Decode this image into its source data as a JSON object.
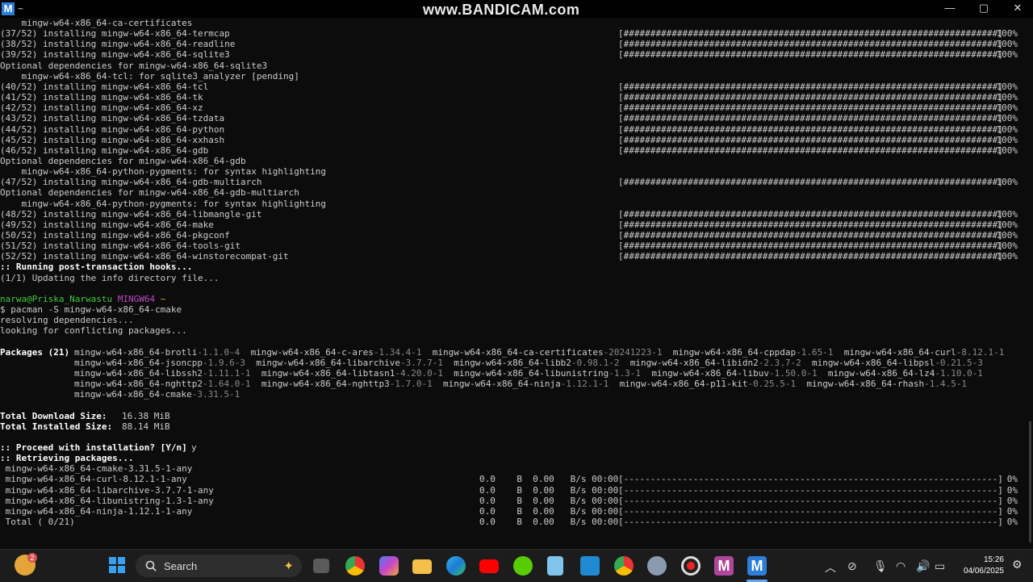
{
  "window": {
    "icon_letter": "M",
    "title": "~",
    "watermark": "www.BANDICAM.com",
    "minimize": "—",
    "maximize": "▢",
    "close": "✕"
  },
  "install_lines": [
    {
      "text": "    mingw-w64-x86_64-ca-certificates",
      "bar": "",
      "pct": ""
    },
    {
      "text": "(37/52) installing mingw-w64-x86_64-termcap",
      "bar": "[######################################################################]",
      "pct": "100%"
    },
    {
      "text": "(38/52) installing mingw-w64-x86_64-readline",
      "bar": "[######################################################################]",
      "pct": "100%"
    },
    {
      "text": "(39/52) installing mingw-w64-x86_64-sqlite3",
      "bar": "[######################################################################]",
      "pct": "100%"
    },
    {
      "text": "Optional dependencies for mingw-w64-x86_64-sqlite3",
      "bar": "",
      "pct": ""
    },
    {
      "text": "    mingw-w64-x86_64-tcl: for sqlite3_analyzer [pending]",
      "bar": "",
      "pct": ""
    },
    {
      "text": "(40/52) installing mingw-w64-x86_64-tcl",
      "bar": "[######################################################################]",
      "pct": "100%"
    },
    {
      "text": "(41/52) installing mingw-w64-x86_64-tk",
      "bar": "[######################################################################]",
      "pct": "100%"
    },
    {
      "text": "(42/52) installing mingw-w64-x86_64-xz",
      "bar": "[######################################################################]",
      "pct": "100%"
    },
    {
      "text": "(43/52) installing mingw-w64-x86_64-tzdata",
      "bar": "[######################################################################]",
      "pct": "100%"
    },
    {
      "text": "(44/52) installing mingw-w64-x86_64-python",
      "bar": "[######################################################################]",
      "pct": "100%"
    },
    {
      "text": "(45/52) installing mingw-w64-x86_64-xxhash",
      "bar": "[######################################################################]",
      "pct": "100%"
    },
    {
      "text": "(46/52) installing mingw-w64-x86_64-gdb",
      "bar": "[######################################################################]",
      "pct": "100%"
    },
    {
      "text": "Optional dependencies for mingw-w64-x86_64-gdb",
      "bar": "",
      "pct": ""
    },
    {
      "text": "    mingw-w64-x86_64-python-pygments: for syntax highlighting",
      "bar": "",
      "pct": ""
    },
    {
      "text": "(47/52) installing mingw-w64-x86_64-gdb-multiarch",
      "bar": "[######################################################################]",
      "pct": "100%"
    },
    {
      "text": "Optional dependencies for mingw-w64-x86_64-gdb-multiarch",
      "bar": "",
      "pct": ""
    },
    {
      "text": "    mingw-w64-x86_64-python-pygments: for syntax highlighting",
      "bar": "",
      "pct": ""
    },
    {
      "text": "(48/52) installing mingw-w64-x86_64-libmangle-git",
      "bar": "[######################################################################]",
      "pct": "100%"
    },
    {
      "text": "(49/52) installing mingw-w64-x86_64-make",
      "bar": "[######################################################################]",
      "pct": "100%"
    },
    {
      "text": "(50/52) installing mingw-w64-x86_64-pkgconf",
      "bar": "[######################################################################]",
      "pct": "100%"
    },
    {
      "text": "(51/52) installing mingw-w64-x86_64-tools-git",
      "bar": "[######################################################################]",
      "pct": "100%"
    },
    {
      "text": "(52/52) installing mingw-w64-x86_64-winstorecompat-git",
      "bar": "[######################################################################]",
      "pct": "100%"
    }
  ],
  "hooks": {
    "running": ":: Running post-transaction hooks...",
    "updating": "(1/1) Updating the info directory file..."
  },
  "prompt": {
    "user_host": "narwa@Priska_Narwastu",
    "env": "MINGW64",
    "dir": "~",
    "command": "$ pacman -S mingw-w64-x86_64-cmake"
  },
  "resolve": [
    "resolving dependencies...",
    "looking for conflicting packages..."
  ],
  "packages": {
    "label": "Packages (21)",
    "rows": [
      [
        [
          "mingw-w64-x86_64-brotli",
          "-1.1.0-4"
        ],
        [
          "mingw-w64-x86_64-c-ares",
          "-1.34.4-1"
        ],
        [
          "mingw-w64-x86_64-ca-certificates",
          "-20241223-1"
        ],
        [
          "mingw-w64-x86_64-cppdap",
          "-1.65-1"
        ],
        [
          "mingw-w64-x86_64-curl",
          "-8.12.1-1"
        ]
      ],
      [
        [
          "mingw-w64-x86_64-jsoncpp",
          "-1.9.6-3"
        ],
        [
          "mingw-w64-x86_64-libarchive",
          "-3.7.7-1"
        ],
        [
          "mingw-w64-x86_64-libb2",
          "-0.98.1-2"
        ],
        [
          "mingw-w64-x86_64-libidn2",
          "-2.3.7-2"
        ],
        [
          "mingw-w64-x86_64-libpsl",
          "-0.21.5-3"
        ]
      ],
      [
        [
          "mingw-w64-x86_64-libssh2",
          "-1.11.1-1"
        ],
        [
          "mingw-w64-x86_64-libtasn1",
          "-4.20.0-1"
        ],
        [
          "mingw-w64-x86_64-libunistring",
          "-1.3-1"
        ],
        [
          "mingw-w64-x86_64-libuv",
          "-1.50.0-1"
        ],
        [
          "mingw-w64-x86_64-lz4",
          "-1.10.0-1"
        ]
      ],
      [
        [
          "mingw-w64-x86_64-nghttp2",
          "-1.64.0-1"
        ],
        [
          "mingw-w64-x86_64-nghttp3",
          "-1.7.0-1"
        ],
        [
          "mingw-w64-x86_64-ninja",
          "-1.12.1-1"
        ],
        [
          "mingw-w64-x86_64-p11-kit",
          "-0.25.5-1"
        ],
        [
          "mingw-w64-x86_64-rhash",
          "-1.4.5-1"
        ]
      ],
      [
        [
          "mingw-w64-x86_64-cmake",
          "-3.31.5-1"
        ]
      ]
    ]
  },
  "sizes": {
    "download_label": "Total Download Size:",
    "download_value": "16.38 MiB",
    "installed_label": "Total Installed Size:",
    "installed_value": "88.14 MiB"
  },
  "proceed": {
    "question": ":: Proceed with installation? [Y/n]",
    "answer": "y",
    "retrieving": ":: Retrieving packages..."
  },
  "downloads": [
    {
      "name": " mingw-w64-x86_64-cmake-3.31.5-1-any",
      "stats": "",
      "bar": "",
      "pct": ""
    },
    {
      "name": " mingw-w64-x86_64-curl-8.12.1-1-any",
      "stats": "0.0    B  0.00   B/s 00:00",
      "bar": "[----------------------------------------------------------------------]",
      "pct": "0%"
    },
    {
      "name": " mingw-w64-x86_64-libarchive-3.7.7-1-any",
      "stats": "0.0    B  0.00   B/s 00:00",
      "bar": "[----------------------------------------------------------------------]",
      "pct": "0%"
    },
    {
      "name": " mingw-w64-x86_64-libunistring-1.3-1-any",
      "stats": "0.0    B  0.00   B/s 00:00",
      "bar": "[----------------------------------------------------------------------]",
      "pct": "0%"
    },
    {
      "name": " mingw-w64-x86_64-ninja-1.12.1-1-any",
      "stats": "0.0    B  0.00   B/s 00:00",
      "bar": "[----------------------------------------------------------------------]",
      "pct": "0%"
    },
    {
      "name": " Total ( 0/21)",
      "stats": "0.0    B  0.00   B/s 00:00",
      "bar": "[----------------------------------------------------------------------]",
      "pct": "0%"
    }
  ],
  "taskbar": {
    "search_label": "Search",
    "weather_badge": "2",
    "time": "15:26",
    "date": "04/06/2025",
    "colors": {
      "bg": "#1c1c1c",
      "accent": "#3fc73f"
    }
  }
}
